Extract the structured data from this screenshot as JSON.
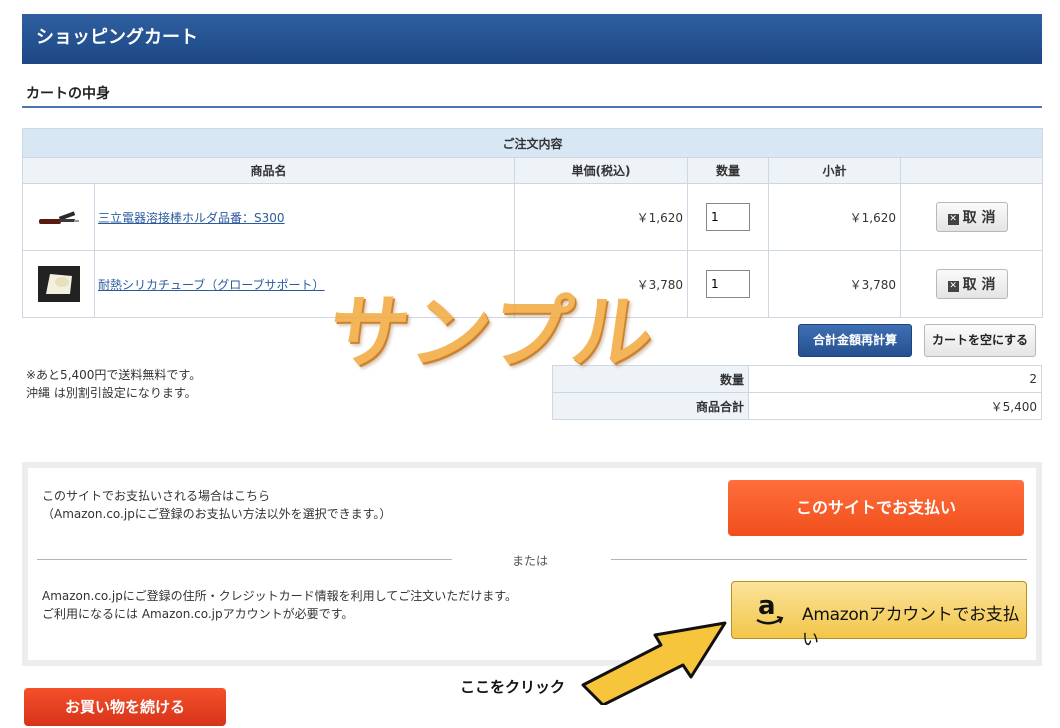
{
  "page": {
    "title": "ショッピングカート",
    "section_title": "カートの中身"
  },
  "cart": {
    "caption": "ご注文内容",
    "headers": {
      "name": "商品名",
      "price": "単価(税込)",
      "qty": "数量",
      "subtotal": "小計"
    },
    "items": [
      {
        "name": "三立電器溶接棒ホルダ品番：S300",
        "price": "￥1,620",
        "qty": "1",
        "subtotal": "￥1,620",
        "cancel": "取 消",
        "thumb_icon": "welding-holder-icon"
      },
      {
        "name": "耐熱シリカチューブ（グローブサポート）",
        "price": "￥3,780",
        "qty": "1",
        "subtotal": "￥3,780",
        "cancel": "取 消",
        "thumb_icon": "silica-tube-icon"
      }
    ],
    "recalc_label": "合計金額再計算",
    "empty_label": "カートを空にする"
  },
  "notes": {
    "line1": "※あと5,400円で送料無料です。",
    "line2": "沖縄 は別割引設定になります。"
  },
  "summary": {
    "qty_label": "数量",
    "qty_value": "2",
    "total_label": "商品合計",
    "total_value": "￥5,400"
  },
  "payment": {
    "site_text1": "このサイトでお支払いされる場合はこちら",
    "site_text2": "（Amazon.co.jpにご登録のお支払い方法以外を選択できます。）",
    "site_button": "このサイトでお支払い",
    "or_text": "または",
    "amazon_text1": "Amazon.co.jpにご登録の住所・クレジットカード情報を利用してご注文いただけます。",
    "amazon_text2": "ご利用になるには Amazon.co.jpアカウントが必要です。",
    "amazon_button": "Amazonアカウントでお支払い",
    "click_here": "ここをクリック"
  },
  "continue_button": "お買い物を続ける",
  "watermark": "サンプル",
  "colors": {
    "header_blue": "#1c4784",
    "site_pay_orange": "#f04f1c",
    "amazon_yellow": "#f2c64a",
    "continue_red": "#d7331a"
  }
}
